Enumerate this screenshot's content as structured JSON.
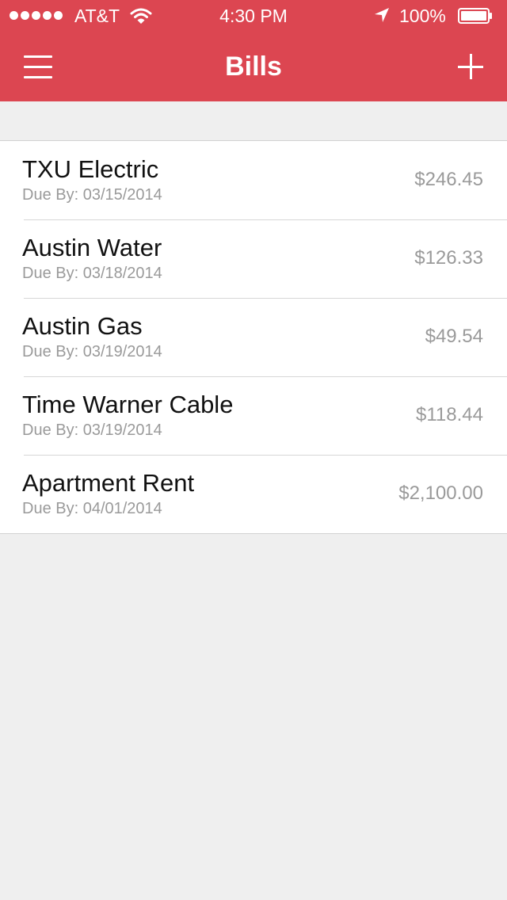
{
  "status_bar": {
    "carrier": "AT&T",
    "time": "4:30 PM",
    "battery": "100%"
  },
  "nav": {
    "title": "Bills",
    "menu_icon": "hamburger-menu-icon",
    "add_icon": "plus-icon"
  },
  "colors": {
    "header_red": "#dc4651",
    "background": "#efefef",
    "secondary_text": "#9a9a9a"
  },
  "bills": [
    {
      "name": "TXU Electric",
      "due": "Due By: 03/15/2014",
      "amount": "$246.45"
    },
    {
      "name": "Austin Water",
      "due": "Due By: 03/18/2014",
      "amount": "$126.33"
    },
    {
      "name": "Austin Gas",
      "due": "Due By: 03/19/2014",
      "amount": "$49.54"
    },
    {
      "name": "Time Warner Cable",
      "due": "Due By: 03/19/2014",
      "amount": "$118.44"
    },
    {
      "name": "Apartment Rent",
      "due": "Due By: 04/01/2014",
      "amount": "$2,100.00"
    }
  ]
}
